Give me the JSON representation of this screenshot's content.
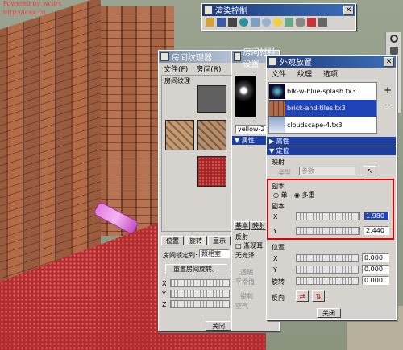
{
  "watermark": {
    "line1": "Powered by wcdrs",
    "line2": "http://icax.cn"
  },
  "render_toolbar": {
    "title": "渲染控制",
    "icons": [
      "folder-icon",
      "save-icon",
      "camera-icon",
      "globe-icon",
      "cube-icon",
      "sphere-icon",
      "bulb-icon",
      "eye-icon",
      "gear-icon",
      "render-icon",
      "grid-icon"
    ]
  },
  "room_texture": {
    "title": "房间纹理器",
    "menu": [
      "文件(F)",
      "房间(R)"
    ],
    "group_label": "房间纹理",
    "tabs": [
      "位置",
      "旋转",
      "显示"
    ],
    "lock_label": "房间锁定到:",
    "lock_value": "照相室",
    "reset_button": "重置房间旋转。",
    "axes": [
      "X",
      "Y",
      "Z"
    ],
    "close_button": "关闭",
    "textures": [
      "blank-gray",
      "tan-tile",
      "red-brick"
    ]
  },
  "room_material": {
    "title": "房间材料设置",
    "field_value": "yellow-2",
    "section_attr": "属性",
    "tabs": [
      "基本",
      "映射"
    ],
    "reflect_label": "反射",
    "checkbox_label": "渐现耳",
    "no_light_label": "无光泽",
    "smooth_label": "透明",
    "smooth2_label": "平滑值",
    "sharp_label": "锐利",
    "space_label": "空气"
  },
  "appearance": {
    "title": "外观放置",
    "menu": [
      "文件",
      "纹理",
      "选项"
    ],
    "files": [
      "blk-w-blue-splash.tx3",
      "brick-and-tiles.tx3",
      "cloudscape-4.tx3"
    ],
    "selected_file_index": 1,
    "section_attr": "属性",
    "section_position": "定位",
    "mapping_label": "映射",
    "type_label": "类型",
    "type_value": "参数",
    "copies_label": "副本",
    "single_label": "单",
    "multi_label": "多重",
    "copies_group": "副本",
    "x_label": "X",
    "x_value": "1.980",
    "y_label": "Y",
    "y_value": "2.440",
    "position_label": "位置",
    "pos_x_label": "X",
    "pos_x_value": "0.000",
    "pos_y_label": "Y",
    "pos_y_value": "0.000",
    "rotate_label": "旋转",
    "rotate_value": "0.000",
    "reverse_label": "反向",
    "close_button": "关闭",
    "side_plus": "+",
    "side_minus": "-"
  },
  "right_toolbar": {
    "icons": [
      "search-icon",
      "hand-icon",
      "zoom-icon",
      "plus-icon",
      "rotate-icon"
    ]
  }
}
